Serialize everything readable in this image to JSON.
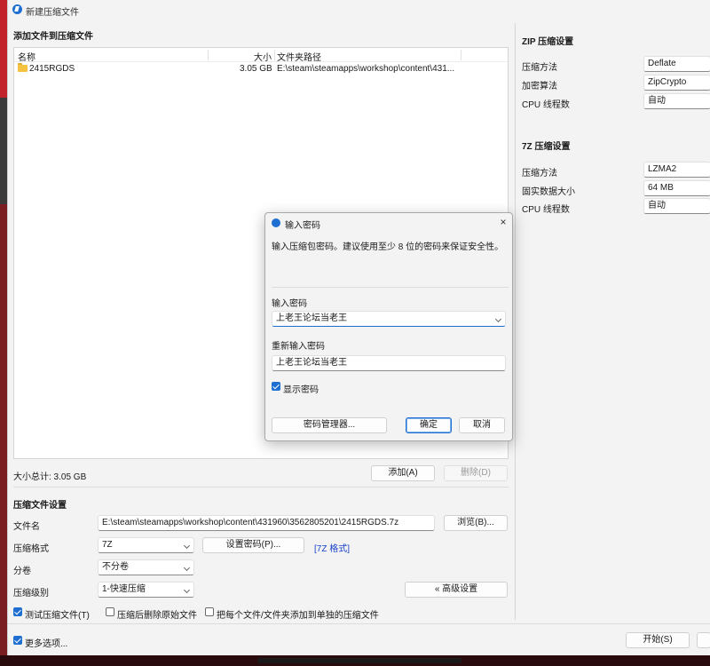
{
  "window": {
    "title": "新建压缩文件"
  },
  "add_files": {
    "heading": "添加文件到压缩文件",
    "columns": {
      "name": "名称",
      "size": "大小",
      "path": "文件夹路径"
    },
    "rows": [
      {
        "name": "2415RGDS",
        "size": "3.05 GB",
        "path": "E:\\steam\\steamapps\\workshop\\content\\431..."
      }
    ],
    "total": "大小总计: 3.05 GB",
    "add_label": "添加(A)",
    "delete_label": "删除(D)"
  },
  "settings": {
    "heading": "压缩文件设置",
    "filename_label": "文件名",
    "filename_value": "E:\\steam\\steamapps\\workshop\\content\\431960\\3562805201\\2415RGDS.7z",
    "browse_label": "浏览(B)...",
    "format_label": "压缩格式",
    "format_value": "7Z",
    "set_password_label": "设置密码(P)...",
    "format_link": "[7Z 格式]",
    "split_label": "分卷",
    "split_value": "不分卷",
    "level_label": "压缩级别",
    "level_value": "1-快速压缩",
    "advanced_label": "« 高级设置",
    "test_label": "测试压缩文件(T)",
    "delete_after_label": "压缩后删除原始文件",
    "separate_label": "把每个文件/文件夹添加到单独的压缩文件",
    "more_options_label": "更多选项...",
    "start_label": "开始(S)"
  },
  "zip": {
    "heading": "ZIP 压缩设置",
    "method_label": "压缩方法",
    "method_value": "Deflate",
    "encrypt_label": "加密算法",
    "encrypt_value": "ZipCrypto",
    "threads_label": "CPU 线程数",
    "threads_value": "自动"
  },
  "sevenz": {
    "heading": "7Z 压缩设置",
    "method_label": "压缩方法",
    "method_value": "LZMA2",
    "solid_label": "固实数据大小",
    "solid_value": "64 MB",
    "threads_label": "CPU 线程数",
    "threads_value": "自动"
  },
  "dialog": {
    "title": "输入密码",
    "message": "输入压缩包密码。建议使用至少 8 位的密码来保证安全性。",
    "password_label": "输入密码",
    "password_value": "上老王论坛当老王",
    "reenter_label": "重新输入密码",
    "reenter_value": "上老王论坛当老王",
    "show_password_label": "显示密码",
    "manager_label": "密码管理器...",
    "ok_label": "确定",
    "cancel_label": "取消"
  },
  "colors": {
    "accent": "#1e6fd1",
    "link": "#1a44c9",
    "desktop": "#b3141a"
  }
}
